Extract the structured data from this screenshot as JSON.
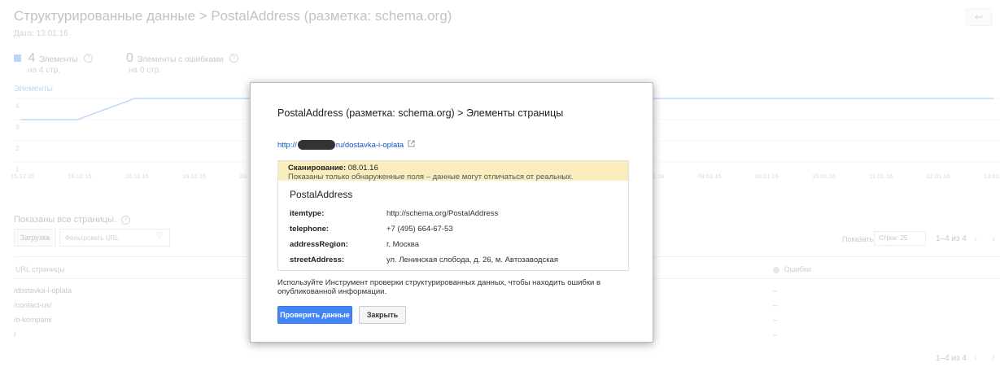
{
  "page": {
    "title": "Структурированные данные > PostalAddress (разметка: schema.org)",
    "date": "Дата: 13.01.16",
    "metrics": [
      {
        "value": "4",
        "label": "Элементы",
        "sub": "на 4 стр."
      },
      {
        "value": "0",
        "label": "Элементы с ошибками",
        "sub": "на 0 стр."
      }
    ],
    "chart_label": "Элементы",
    "y_ticks": [
      "4",
      "3",
      "2",
      "1"
    ],
    "x_ticks": [
      "15.12.15",
      "16.12.15",
      "18.12.15",
      "19.12.15",
      "20.12.15",
      "21.12.15",
      "22.12.15",
      "04.01.16",
      "05.01.16",
      "06.01.16",
      "07.01.16",
      "08.01.16",
      "09.01.16",
      "10.01.16",
      "10.01.16",
      "11.01.16",
      "12.01.16",
      "13.01."
    ],
    "shown_all": "Показаны все страницы.",
    "download_label": "Загрузка",
    "filter_placeholder": "Фильтровать URL",
    "show_label": "Показать:",
    "rows_select": "Строк: 25",
    "pager_range": "1–4 из 4",
    "col_url": "URL страницы",
    "col_errors": "Ошибки",
    "rows": [
      {
        "url": "/dostavka-i-oplata",
        "errors": "–"
      },
      {
        "url": "/contact-us/",
        "errors": "–"
      },
      {
        "url": "/o-kompanii",
        "errors": "–"
      },
      {
        "url": "/",
        "errors": "–"
      }
    ],
    "back_icon": "↩"
  },
  "modal": {
    "title": "PostalAddress (разметка: schema.org) > Элементы страницы",
    "url_prefix": "http://",
    "url_suffix": "ru/dostavka-i-oplata",
    "scan_label": "Сканирование:",
    "scan_date": "08.01.16",
    "scan_note": "Показаны только обнаруженные поля – данные могут отличаться от реальных.",
    "item_type_title": "PostalAddress",
    "properties": [
      {
        "key": "itemtype:",
        "value": "http://schema.org/PostalAddress"
      },
      {
        "key": "telephone:",
        "value": "+7 (495) 664-67-53"
      },
      {
        "key": "addressRegion:",
        "value": "г. Москва"
      },
      {
        "key": "streetAddress:",
        "value": "ул. Ленинская слобода, д. 26, м. Автозаводская"
      }
    ],
    "note": "Используйте Инструмент проверки структурированных данных, чтобы находить ошибки в опубликованной информации.",
    "check_button": "Проверить данные",
    "close_button": "Закрыть"
  },
  "colors": {
    "accent": "#4285f4",
    "line": "#8ab4f8",
    "warning_bg": "#f9edbe"
  },
  "chart_data": {
    "type": "line",
    "title": "",
    "categories": [
      "15.12.15",
      "16.12.15",
      "18.12.15",
      "19.12.15",
      "20.12.15",
      "21.12.15",
      "22.12.15",
      "04.01.16",
      "05.01.16",
      "06.01.16",
      "07.01.16",
      "08.01.16",
      "09.01.16",
      "10.01.16",
      "10.01.16",
      "11.01.16",
      "12.01.16",
      "13.01."
    ],
    "series": [
      {
        "values": [
          3,
          3,
          4,
          4,
          4,
          4,
          4,
          3,
          3,
          3,
          3,
          4,
          4,
          4,
          4,
          4,
          4,
          4
        ]
      }
    ],
    "ylabel": "Элементы",
    "ylim": [
      0,
      4
    ],
    "grid": true
  }
}
